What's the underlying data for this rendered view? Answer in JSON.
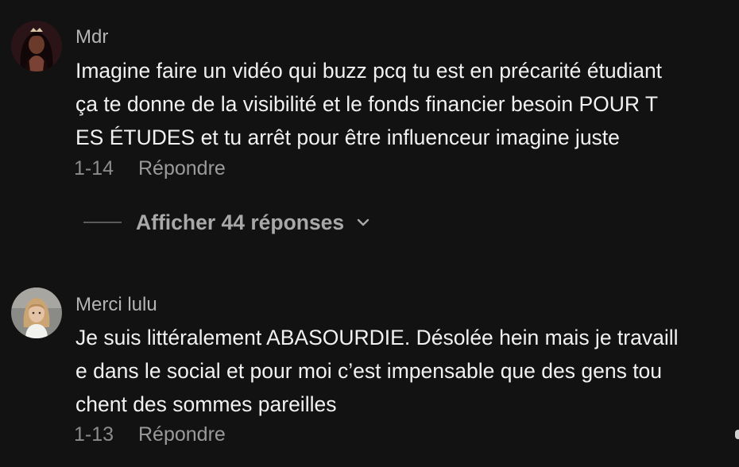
{
  "comments": [
    {
      "username": "Mdr",
      "avatar_icon": "avatar-dark-hair-woman",
      "text_lines": [
        "Imagine faire un vidéo qui buzz pcq tu est en précarité étudiant",
        "ça te donne de la visibilité et le fonds financier besoin POUR T",
        "ES ÉTUDES et tu arrêt pour être influenceur imagine juste"
      ],
      "date": "1-14",
      "reply_label": "Répondre",
      "view_replies_label": "Afficher 44 réponses",
      "view_replies_icon": "chevron-down-icon"
    },
    {
      "username": "Merci lulu",
      "avatar_icon": "avatar-blonde-woman",
      "text_lines": [
        "Je suis littéralement ABASOURDIE. Désolée hein mais je travaill",
        "e dans le social et pour moi c’est impensable que des gens tou",
        "chent des sommes pareilles"
      ],
      "date": "1-13",
      "reply_label": "Répondre"
    }
  ],
  "colors": {
    "background": "#121212",
    "username": "#b4b4b4",
    "text": "#f1f1f1",
    "meta": "#8c8c8c"
  }
}
